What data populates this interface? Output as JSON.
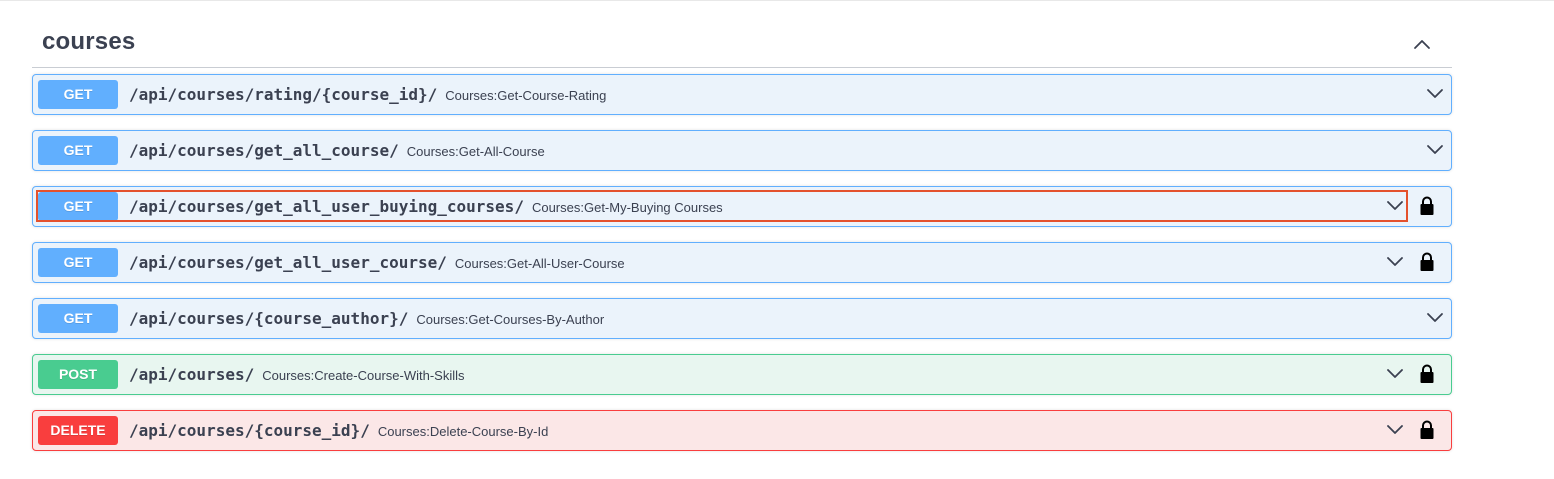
{
  "section": {
    "title": "courses",
    "expanded": true,
    "toggle_icon": "chevron-up-icon"
  },
  "colors": {
    "get": "#61affe",
    "post": "#49cc90",
    "delete": "#f93e3e",
    "focus_outline": "#e4512d"
  },
  "operations": [
    {
      "method": "GET",
      "path": "/api/courses/rating/{course_id}/",
      "summary": "Courses:Get-Course-Rating",
      "locked": false,
      "focused": false
    },
    {
      "method": "GET",
      "path": "/api/courses/get_all_course/",
      "summary": "Courses:Get-All-Course",
      "locked": false,
      "focused": false
    },
    {
      "method": "GET",
      "path": "/api/courses/get_all_user_buying_courses/",
      "summary": "Courses:Get-My-Buying Courses",
      "locked": true,
      "focused": true
    },
    {
      "method": "GET",
      "path": "/api/courses/get_all_user_course/",
      "summary": "Courses:Get-All-User-Course",
      "locked": true,
      "focused": false
    },
    {
      "method": "GET",
      "path": "/api/courses/{course_author}/",
      "summary": "Courses:Get-Courses-By-Author",
      "locked": false,
      "focused": false
    },
    {
      "method": "POST",
      "path": "/api/courses/",
      "summary": "Courses:Create-Course-With-Skills",
      "locked": true,
      "focused": false
    },
    {
      "method": "DELETE",
      "path": "/api/courses/{course_id}/",
      "summary": "Courses:Delete-Course-By-Id",
      "locked": true,
      "focused": false
    }
  ]
}
